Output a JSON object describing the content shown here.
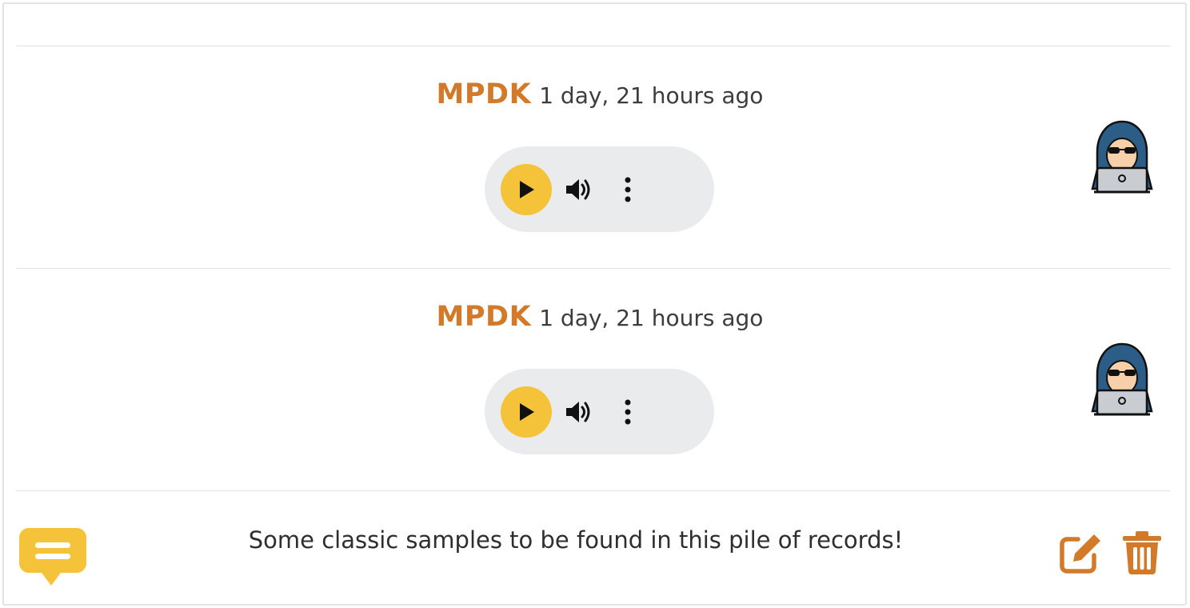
{
  "colors": {
    "accent": "#d27a2a",
    "play_button": "#f4c33a",
    "player_bg": "#eaebec",
    "comment_icon": "#f4c33a"
  },
  "recordings": [
    {
      "author": "MPDK",
      "time": "1 day, 21 hours ago",
      "wave_icon": "audio-wave-icon",
      "avatar_icon": "hacker-avatar-icon"
    },
    {
      "author": "MPDK",
      "time": "1 day, 21 hours ago",
      "wave_icon": "audio-wave-icon",
      "avatar_icon": "hacker-avatar-icon"
    }
  ],
  "player_icons": {
    "play": "play-icon",
    "volume": "volume-icon",
    "more": "more-vertical-icon"
  },
  "comment": {
    "icon": "chat-bubble-icon",
    "text": "Some classic samples to be found in this pile of records!",
    "edit_icon": "edit-icon",
    "delete_icon": "trash-icon"
  }
}
